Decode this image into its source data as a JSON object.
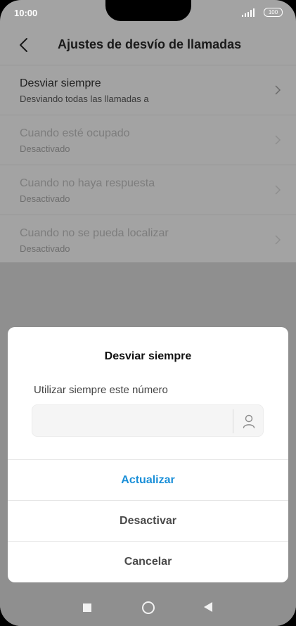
{
  "status_bar": {
    "time": "10:00",
    "battery": "100"
  },
  "header": {
    "title": "Ajustes de desvío de llamadas"
  },
  "list": [
    {
      "title": "Desviar siempre",
      "subtitle": "Desviando todas las llamadas a",
      "enabled": true
    },
    {
      "title": "Cuando esté ocupado",
      "subtitle": "Desactivado",
      "enabled": false
    },
    {
      "title": "Cuando no haya respuesta",
      "subtitle": "Desactivado",
      "enabled": false
    },
    {
      "title": "Cuando no se pueda localizar",
      "subtitle": "Desactivado",
      "enabled": false
    }
  ],
  "dialog": {
    "title": "Desviar siempre",
    "label": "Utilizar siempre este número",
    "number_value": "",
    "update_label": "Actualizar",
    "deactivate_label": "Desactivar",
    "cancel_label": "Cancelar"
  },
  "colors": {
    "accent": "#1a8fd8",
    "scrim": "#a3a3a3"
  }
}
